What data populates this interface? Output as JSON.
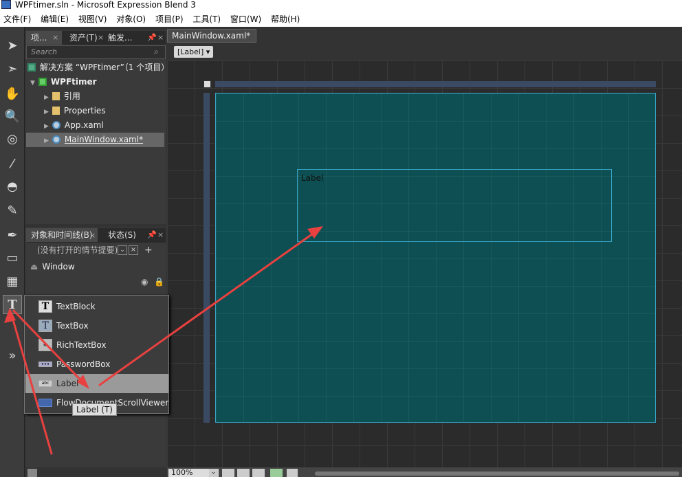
{
  "window": {
    "title": "WPFtimer.sln - Microsoft Expression Blend 3"
  },
  "menu": [
    "文件(F)",
    "编辑(E)",
    "视图(V)",
    "对象(O)",
    "项目(P)",
    "工具(T)",
    "窗口(W)",
    "帮助(H)"
  ],
  "project_panel": {
    "tabs": [
      "项...",
      "资产(T)",
      "触发..."
    ],
    "search_placeholder": "Search",
    "tree": [
      "解决方案 “WPFtimer”（1 个项目）",
      "WPFtimer",
      "引用",
      "Properties",
      "App.xaml",
      "MainWindow.xaml*"
    ]
  },
  "objects_panel": {
    "tabs": [
      "对象和时间线(B)",
      "状态(S)"
    ],
    "scenario_text": "(没有打开的情节提要)",
    "root": "Window"
  },
  "document": {
    "tab": "MainWindow.xaml*",
    "breadcrumb": "[Label]",
    "canvas_label": "Label",
    "zoom": "100%"
  },
  "popup_menu": {
    "items": [
      "TextBlock",
      "TextBox",
      "RichTextBox",
      "PasswordBox",
      "Label",
      "FlowDocumentScrollViewer"
    ],
    "highlighted": "Label",
    "tooltip": "Label (T)"
  },
  "colors": {
    "annotation_arrow": "#e8413f",
    "window_fill": "#0d4f52",
    "selection": "#38a5c6"
  }
}
